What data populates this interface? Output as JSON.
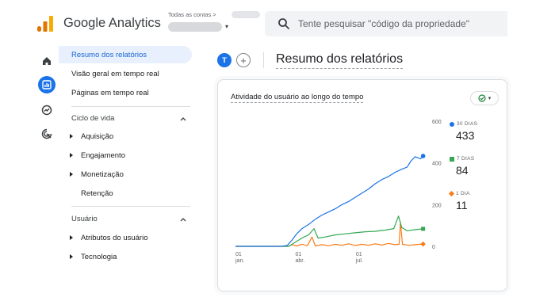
{
  "header": {
    "app_title": "Google Analytics",
    "account_label": "Todas as contas >",
    "search_placeholder": "Tente pesquisar \"código da propriedade\""
  },
  "nav": {
    "active_item": "Resumo dos relatórios",
    "items_top": [
      "Visão geral em tempo real",
      "Páginas em tempo real"
    ],
    "section_lifecycle": "Ciclo de vida",
    "lifecycle_items": [
      "Aquisição",
      "Engajamento",
      "Monetização",
      "Retenção"
    ],
    "section_user": "Usuário",
    "user_items": [
      "Atributos do usuário",
      "Tecnologia"
    ]
  },
  "main": {
    "avatar_letter": "T",
    "add_symbol": "+",
    "page_title": "Resumo dos relatórios",
    "card_title": "Atividade do usuário ao longo do tempo"
  },
  "legend": {
    "d30_label": "30 DIAS",
    "d30_value": "433",
    "d7_label": "7 DIAS",
    "d7_value": "84",
    "d1_label": "1 DIA",
    "d1_value": "11"
  },
  "colors": {
    "d30": "#1a73e8",
    "d7": "#34a853",
    "d1": "#fa7b17"
  },
  "chart_data": {
    "type": "line",
    "x_ticks": [
      {
        "day": "01",
        "month": "jan.",
        "index": 0
      },
      {
        "day": "01",
        "month": "abr.",
        "index": 90
      },
      {
        "day": "01",
        "month": "jul.",
        "index": 181
      }
    ],
    "y_ticks": [
      0,
      200,
      400,
      600
    ],
    "ylim": [
      0,
      600
    ],
    "xlim": [
      0,
      286
    ],
    "series": [
      {
        "name": "30 DIAS",
        "color": "#1a73e8",
        "points": [
          [
            0,
            0
          ],
          [
            70,
            0
          ],
          [
            78,
            5
          ],
          [
            85,
            30
          ],
          [
            92,
            60
          ],
          [
            100,
            85
          ],
          [
            110,
            105
          ],
          [
            120,
            130
          ],
          [
            130,
            150
          ],
          [
            140,
            165
          ],
          [
            150,
            180
          ],
          [
            160,
            200
          ],
          [
            170,
            215
          ],
          [
            180,
            235
          ],
          [
            190,
            255
          ],
          [
            200,
            275
          ],
          [
            210,
            300
          ],
          [
            220,
            320
          ],
          [
            230,
            335
          ],
          [
            240,
            355
          ],
          [
            250,
            370
          ],
          [
            258,
            380
          ],
          [
            264,
            410
          ],
          [
            270,
            430
          ],
          [
            278,
            420
          ],
          [
            282,
            433
          ]
        ]
      },
      {
        "name": "7 DIAS",
        "color": "#34a853",
        "points": [
          [
            0,
            0
          ],
          [
            80,
            0
          ],
          [
            90,
            20
          ],
          [
            100,
            40
          ],
          [
            110,
            55
          ],
          [
            118,
            85
          ],
          [
            124,
            40
          ],
          [
            135,
            45
          ],
          [
            150,
            55
          ],
          [
            165,
            60
          ],
          [
            180,
            65
          ],
          [
            195,
            70
          ],
          [
            210,
            72
          ],
          [
            225,
            78
          ],
          [
            238,
            85
          ],
          [
            245,
            145
          ],
          [
            250,
            90
          ],
          [
            258,
            75
          ],
          [
            270,
            80
          ],
          [
            282,
            84
          ]
        ]
      },
      {
        "name": "1 DIA",
        "color": "#fa7b17",
        "points": [
          [
            0,
            0
          ],
          [
            80,
            0
          ],
          [
            85,
            8
          ],
          [
            92,
            2
          ],
          [
            100,
            10
          ],
          [
            108,
            3
          ],
          [
            115,
            45
          ],
          [
            120,
            2
          ],
          [
            130,
            8
          ],
          [
            140,
            3
          ],
          [
            150,
            10
          ],
          [
            160,
            5
          ],
          [
            170,
            12
          ],
          [
            180,
            4
          ],
          [
            190,
            10
          ],
          [
            200,
            5
          ],
          [
            210,
            12
          ],
          [
            220,
            6
          ],
          [
            230,
            14
          ],
          [
            240,
            8
          ],
          [
            246,
            10
          ],
          [
            248,
            115
          ],
          [
            251,
            10
          ],
          [
            260,
            5
          ],
          [
            270,
            8
          ],
          [
            282,
            11
          ]
        ]
      }
    ]
  }
}
